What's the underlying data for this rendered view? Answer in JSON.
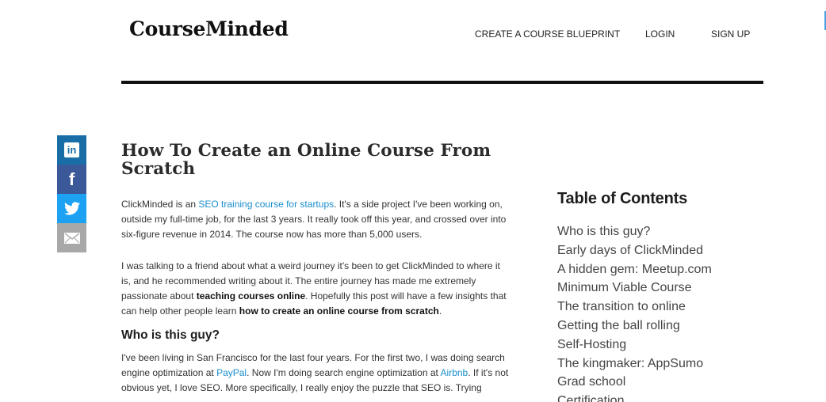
{
  "site": {
    "logo": "CourseMinded"
  },
  "nav": {
    "items": [
      {
        "label": "CREATE A COURSE BLUEPRINT"
      },
      {
        "label": "LOGIN"
      },
      {
        "label": "SIGN UP"
      }
    ]
  },
  "share": {
    "linkedin": "in",
    "facebook": "f"
  },
  "article": {
    "title": "How To Create an Online Course From Scratch",
    "p1": {
      "t1": "ClickMinded is an ",
      "link1": "SEO training course for startups",
      "t2": ". It's a side project I've been working on, outside my full-time job, for the last 3 years. It really took off this year, and crossed over into six-figure revenue in 2014. The course now has more than 5,000 users."
    },
    "p2": {
      "t1": "I was talking to a friend about what a weird journey it's been to get ClickMinded to where it is, and he recommended writing about it. The entire journey has made me extremely passionate about ",
      "b1": "teaching courses online",
      "t2": ". Hopefully this post will have a few insights that can help other people learn ",
      "b2": "how to create an online course from scratch",
      "t3": "."
    },
    "h2": "Who is this guy?",
    "p3": {
      "t1": "I've been living in San Francisco for the last four years. For the first two, I was doing search engine optimization at ",
      "link1": "PayPal",
      "t2": ". Now I'm doing search engine optimization at ",
      "link2": "Airbnb",
      "t3": ". If it's not obvious yet, I love SEO. More specifically, I really enjoy the puzzle that SEO is. Trying"
    }
  },
  "toc": {
    "title": "Table of Contents",
    "items": [
      "Who is this guy?",
      "Early days of ClickMinded",
      "A hidden gem: Meetup.com",
      "Minimum Viable Course",
      "The transition to online",
      "Getting the ball rolling",
      "Self-Hosting",
      "The kingmaker: AppSumo",
      "Grad school",
      "Certification"
    ]
  },
  "colors": {
    "link": "#1a8ecd",
    "linkedin": "#1a6ea8",
    "facebook": "#3b5998",
    "twitter": "#1da1f2",
    "email": "#a8a8a8"
  },
  "icons": [
    "linkedin-icon",
    "facebook-icon",
    "twitter-icon",
    "email-icon"
  ]
}
